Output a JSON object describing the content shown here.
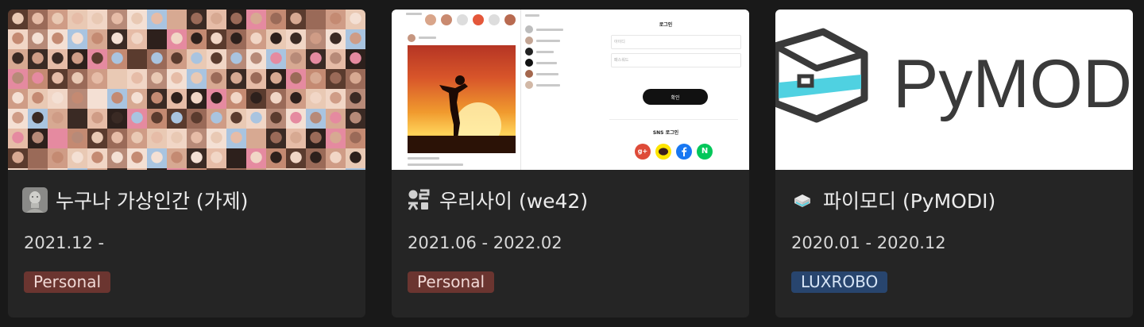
{
  "cards": [
    {
      "title": "누구나 가상인간 (가제)",
      "title_icon": "bust-statue-icon",
      "date": "2021.12 -",
      "tag": "Personal",
      "tag_color": "#6b3530",
      "cover": "face-mosaic-image"
    },
    {
      "title": "우리사이 (we42)",
      "title_icon": "we42-logo-icon",
      "date": "2021.06 - 2022.02",
      "tag": "Personal",
      "tag_color": "#6b3530",
      "cover": "sns-app-mockup-image",
      "mockup": {
        "login_title": "로그인",
        "id_placeholder": "아이디",
        "pw_placeholder": "패스워드",
        "confirm_label": "확인",
        "sns_login": "SNS 로그인",
        "naver_letter": "N",
        "google_letter": "g+"
      }
    },
    {
      "title": "파이모디 (PyMODI)",
      "title_icon": "pymodi-cube-icon",
      "date": "2020.01 - 2020.12",
      "tag": "LUXROBO",
      "tag_color": "#28456e",
      "cover": "pymodi-logo-image",
      "logo_text": "PyMOD"
    }
  ],
  "colors": {
    "background": "#191919",
    "card": "#252525",
    "personal_tag": "#6b3530",
    "luxrobo_tag": "#28456e"
  }
}
